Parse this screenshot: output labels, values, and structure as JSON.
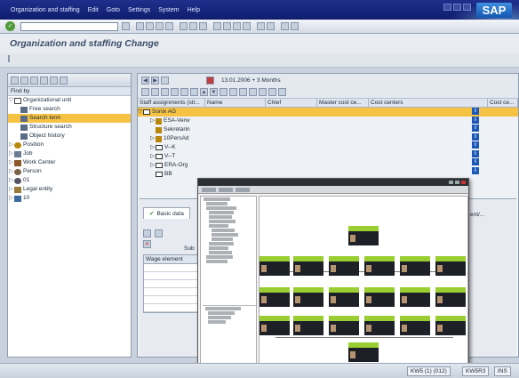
{
  "menu": [
    "Organization and staffing",
    "Edit",
    "Goto",
    "Settings",
    "System",
    "Help"
  ],
  "sap_logo": "SAP",
  "ok_button": "✓",
  "page_title": "Organization and staffing Change",
  "left_panel": {
    "find_by": "Find by",
    "tree": [
      {
        "label": "Organizational unit",
        "icon": "org-unit-icon",
        "expanded": true
      },
      {
        "label": "Free search",
        "icon": "search-icon",
        "indent": 2
      },
      {
        "label": "Search term",
        "icon": "search-icon",
        "indent": 2,
        "selected": true
      },
      {
        "label": "Structure search",
        "icon": "search-icon",
        "indent": 2
      },
      {
        "label": "Object history",
        "icon": "search-icon",
        "indent": 2
      },
      {
        "label": "Position",
        "icon": "position-icon"
      },
      {
        "label": "Job",
        "icon": "job-icon"
      },
      {
        "label": "Work Center",
        "icon": "work-center-icon"
      },
      {
        "label": "Person",
        "icon": "person-icon"
      },
      {
        "label": "01",
        "icon": "gear-icon"
      },
      {
        "label": "Legal entity",
        "icon": "legal-entity-icon"
      },
      {
        "label": "10",
        "icon": "number-icon"
      }
    ]
  },
  "right_panel": {
    "date_range": "13.01.2006  + 3 Months",
    "columns": [
      "Staff assignments (str...",
      "Name",
      "Chief",
      "Master cost ce...",
      "Cost centers",
      "Cost ce..."
    ],
    "rows": [
      {
        "label": "Sonix AG",
        "indent": 0,
        "selected": true
      },
      {
        "label": "ESA-Verw",
        "indent": 1
      },
      {
        "label": "Sekretarin",
        "indent": 1
      },
      {
        "label": "10PersAd",
        "indent": 1
      },
      {
        "label": "V--K",
        "indent": 1
      },
      {
        "label": "V--T",
        "indent": 1
      },
      {
        "label": "ERA-Org",
        "indent": 1
      },
      {
        "label": "BB",
        "indent": 1
      }
    ],
    "detail": {
      "tab_basic": "Basic data",
      "sub_label": "Sub",
      "wage_element": "Wage element",
      "ent_label": "ent/..."
    }
  },
  "status_bar": {
    "session": "KW5 (1) (012)",
    "server": "KW5R3",
    "mode": "INS"
  },
  "colors": {
    "menubar": "#13227a",
    "selection": "#f5c243",
    "chart_green": "#9acd32",
    "chart_dark": "#1d2127"
  }
}
